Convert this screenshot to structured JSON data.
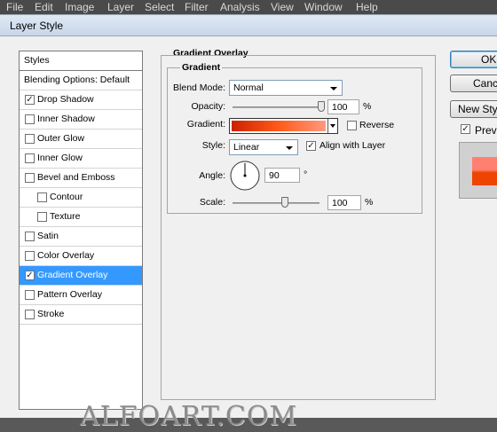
{
  "menubar": [
    "File",
    "Edit",
    "Image",
    "Layer",
    "Select",
    "Filter",
    "Analysis",
    "View",
    "Window",
    "Help"
  ],
  "dialog": {
    "title": "Layer Style"
  },
  "styles_panel": {
    "header": "Styles",
    "items": [
      {
        "label": "Blending Options: Default",
        "checkbox": false,
        "checked": false,
        "active": false
      },
      {
        "label": "Drop Shadow",
        "checkbox": true,
        "checked": true,
        "active": false
      },
      {
        "label": "Inner Shadow",
        "checkbox": true,
        "checked": false,
        "active": false
      },
      {
        "label": "Outer Glow",
        "checkbox": true,
        "checked": false,
        "active": false
      },
      {
        "label": "Inner Glow",
        "checkbox": true,
        "checked": false,
        "active": false
      },
      {
        "label": "Bevel and Emboss",
        "checkbox": true,
        "checked": false,
        "active": false
      },
      {
        "label": "Contour",
        "checkbox": true,
        "checked": false,
        "active": false,
        "indent": true
      },
      {
        "label": "Texture",
        "checkbox": true,
        "checked": false,
        "active": false,
        "indent": true
      },
      {
        "label": "Satin",
        "checkbox": true,
        "checked": false,
        "active": false
      },
      {
        "label": "Color Overlay",
        "checkbox": true,
        "checked": false,
        "active": false
      },
      {
        "label": "Gradient Overlay",
        "checkbox": true,
        "checked": true,
        "active": true
      },
      {
        "label": "Pattern Overlay",
        "checkbox": true,
        "checked": false,
        "active": false
      },
      {
        "label": "Stroke",
        "checkbox": true,
        "checked": false,
        "active": false
      }
    ]
  },
  "gradient_overlay": {
    "section_title": "Gradient Overlay",
    "group_title": "Gradient",
    "blend_mode_label": "Blend Mode:",
    "blend_mode_value": "Normal",
    "opacity_label": "Opacity:",
    "opacity_value": "100",
    "opacity_level": 1.0,
    "opacity_unit": "%",
    "gradient_label": "Gradient:",
    "gradient_colors": [
      "#cc2200",
      "#ff5a1a",
      "#ff9a80"
    ],
    "reverse_label": "Reverse",
    "reverse_checked": false,
    "style_label": "Style:",
    "style_value": "Linear",
    "align_label": "Align with Layer",
    "align_checked": true,
    "angle_label": "Angle:",
    "angle_value": "90",
    "angle_unit": "°",
    "scale_label": "Scale:",
    "scale_value": "100",
    "scale_level": 0.6,
    "scale_unit": "%"
  },
  "buttons": {
    "ok": "OK",
    "cancel": "Cancel",
    "new_style": "New Style...",
    "preview_label": "Preview",
    "preview_checked": true
  },
  "watermark": "ALFOART.COM",
  "colors": {
    "selection": "#3399ff",
    "dialog_bg": "#f0f0f0",
    "preview_top": "#ff8070",
    "preview_bottom": "#ee4400"
  }
}
